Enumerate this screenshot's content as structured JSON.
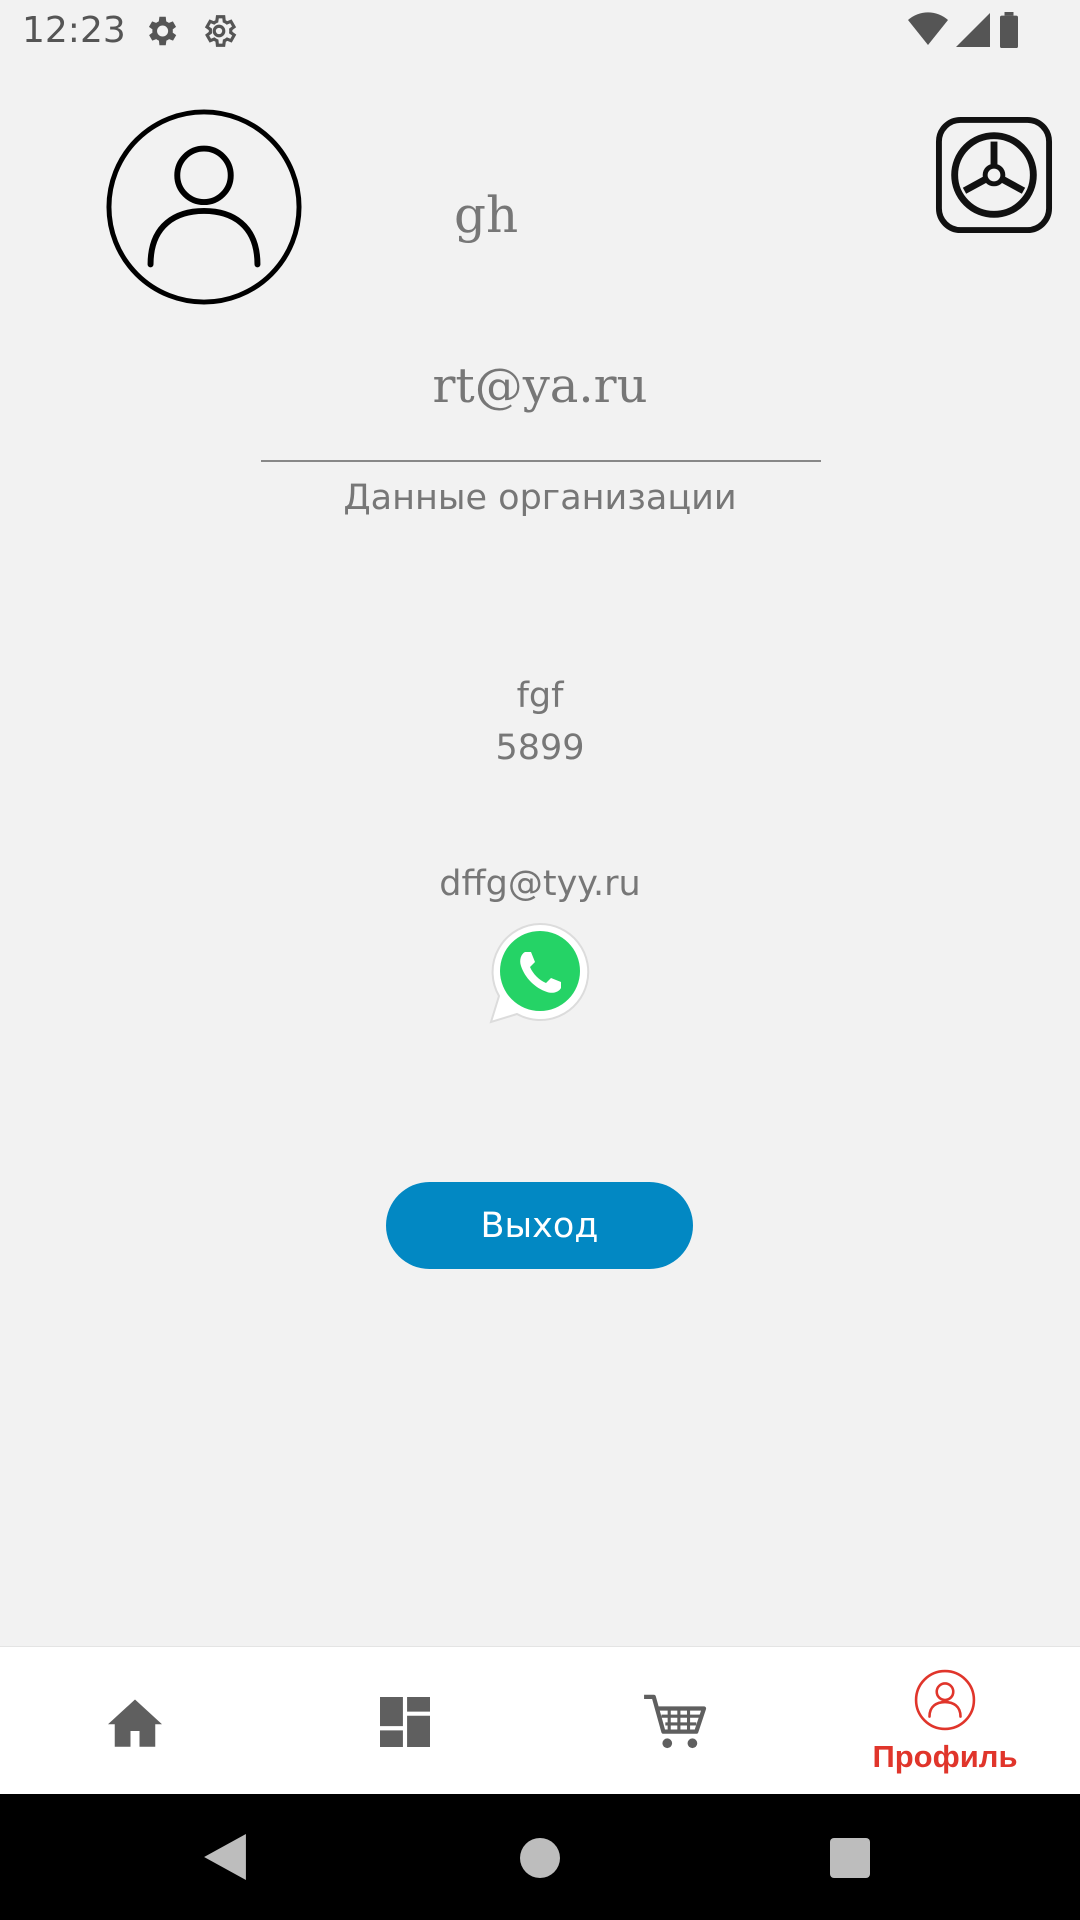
{
  "status_bar": {
    "time": "12:23",
    "icons": [
      "settings-icon",
      "settings-icon",
      "wifi-icon",
      "signal-icon",
      "battery-icon"
    ]
  },
  "profile": {
    "username": "gh",
    "email": "rt@ya.ru",
    "section_title": "Данные организации",
    "org_name": "fgf",
    "org_code": "5899",
    "org_email": "dffg@tyy.ru"
  },
  "actions": {
    "logout_label": "Выход"
  },
  "bottom_nav": {
    "items": [
      {
        "icon": "home-icon",
        "label": ""
      },
      {
        "icon": "dashboard-icon",
        "label": ""
      },
      {
        "icon": "cart-icon",
        "label": ""
      },
      {
        "icon": "profile-icon",
        "label": "Профиль"
      }
    ],
    "active_index": 3
  },
  "colors": {
    "background": "#f2f2f2",
    "accent": "#0288c3",
    "active_nav": "#e0352b",
    "whatsapp": "#25d366"
  }
}
